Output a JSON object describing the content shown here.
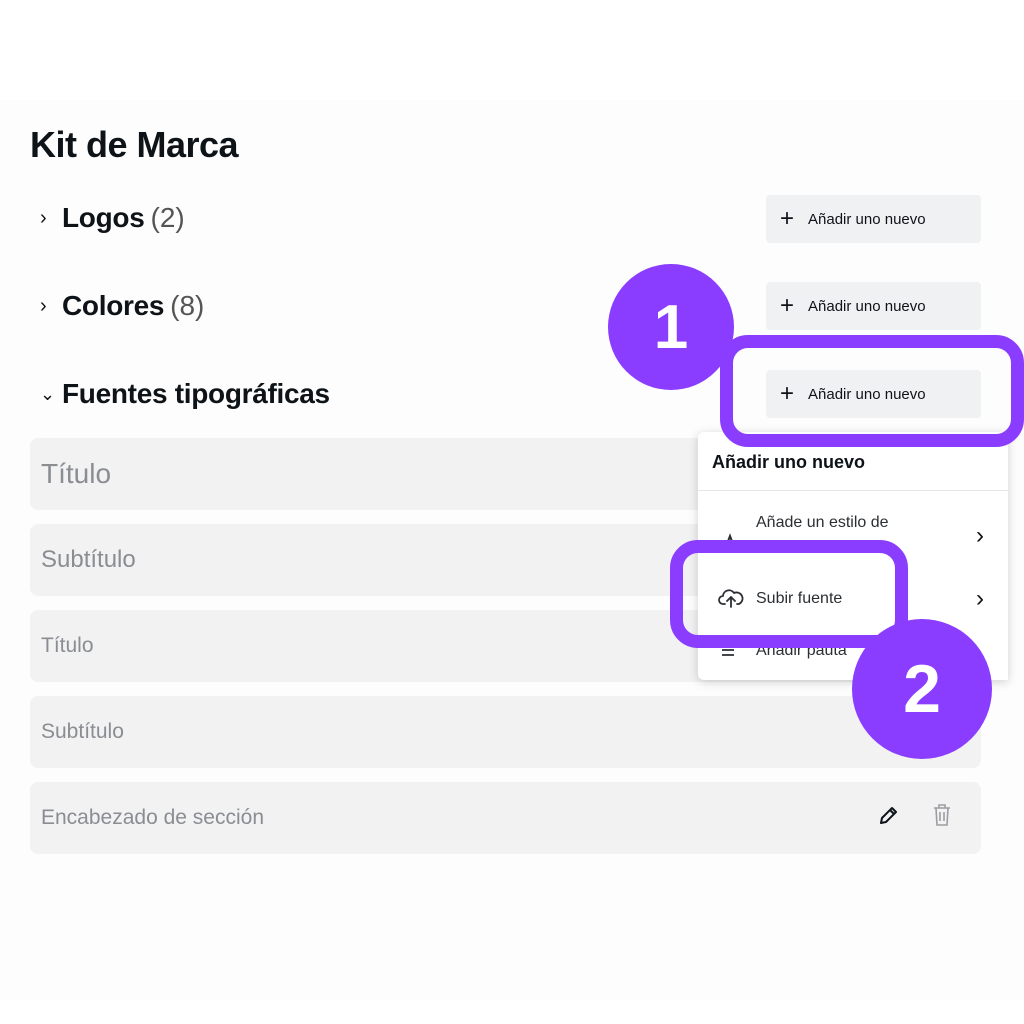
{
  "page": {
    "title": "Kit de Marca"
  },
  "sections": [
    {
      "label": "Logos",
      "count": "(2)",
      "chevron": "›",
      "expanded": false
    },
    {
      "label": "Colores",
      "count": "(8)",
      "chevron": "›",
      "expanded": false
    },
    {
      "label": "Fuentes tipográficas",
      "count": "",
      "chevron": "⌄",
      "expanded": true
    }
  ],
  "add_button": {
    "label": "Añadir uno nuevo",
    "icon": "plus-icon"
  },
  "font_rows": [
    {
      "label": "Título"
    },
    {
      "label": "Subtítulo"
    },
    {
      "label": "Título"
    },
    {
      "label": "Subtítulo"
    },
    {
      "label": "Encabezado de sección"
    }
  ],
  "dropdown": {
    "title": "Añadir uno nuevo",
    "items": [
      {
        "label": "Añade un estilo de",
        "icon": "text-style-icon"
      },
      {
        "label": "Subir fuente",
        "icon": "cloud-upload-icon"
      },
      {
        "label": "Añadir pauta",
        "icon": "list-icon"
      }
    ]
  },
  "annotations": {
    "step1": "1",
    "step2": "2",
    "accent": "#8b3dff"
  }
}
